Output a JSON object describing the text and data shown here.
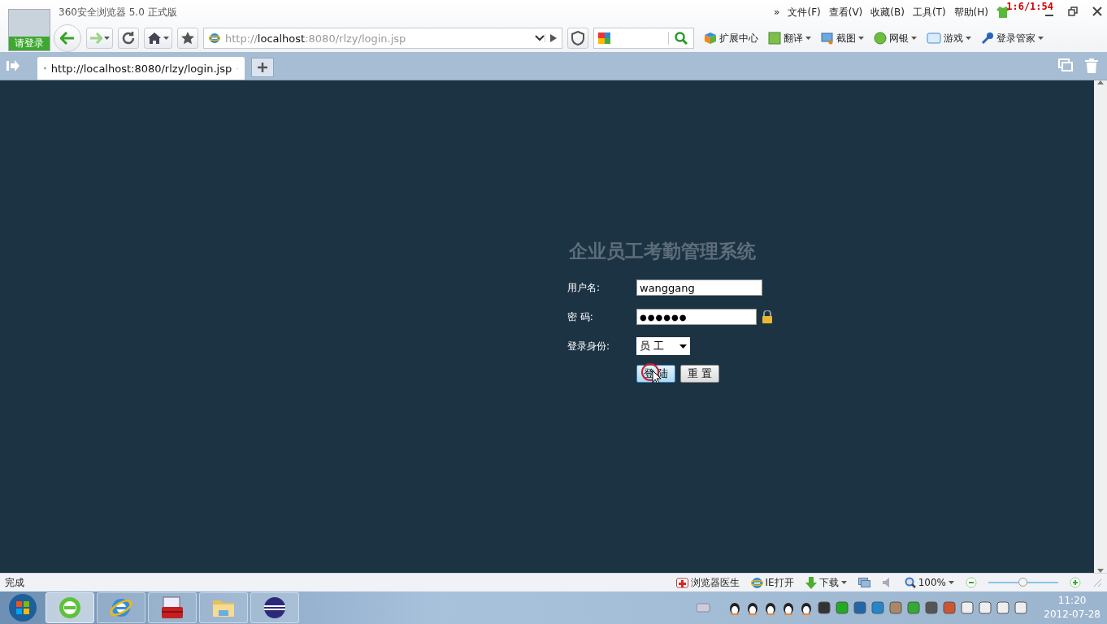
{
  "window": {
    "title": "360安全浏览器 5.0 正式版",
    "login_badge": "请登录",
    "overlay_timer": "1:6/1:54"
  },
  "menu": [
    "»",
    "文件(F)",
    "查看(V)",
    "收藏(B)",
    "工具(T)",
    "帮助(H)"
  ],
  "toolbar": {
    "address": "http://**localhost**:8080/rlzy/login.jsp",
    "extensions": [
      {
        "kind": "cube",
        "label": "扩展中心",
        "dropdown": false
      },
      {
        "kind": "translate",
        "label": "翻译",
        "dropdown": true
      },
      {
        "kind": "screenshot",
        "label": "截图",
        "dropdown": true
      },
      {
        "kind": "bank",
        "label": "网银",
        "dropdown": true
      },
      {
        "kind": "game",
        "label": "游戏",
        "dropdown": true
      },
      {
        "kind": "key",
        "label": "登录管家",
        "dropdown": true
      }
    ]
  },
  "tabs": [
    {
      "label": "http://localhost:8080/rlzy/login.jsp",
      "selected": true
    }
  ],
  "page": {
    "title": "企业员工考勤管理系统",
    "fields": [
      {
        "kind": "text",
        "label": "用户名:",
        "value": "wanggang"
      },
      {
        "kind": "password",
        "label": "密 码:",
        "value": "●●●●●●"
      },
      {
        "kind": "select",
        "label": "登录身份:",
        "value": "员 工"
      }
    ],
    "buttons": [
      {
        "label": "登 陆",
        "focused": true
      },
      {
        "label": "重 置",
        "focused": false
      }
    ]
  },
  "status_bar": {
    "text": "完成",
    "items": [
      {
        "kind": "doctor",
        "label": "浏览器医生",
        "dropdown": false
      },
      {
        "kind": "ie",
        "label": "IE打开",
        "dropdown": false
      },
      {
        "kind": "download",
        "label": "下载",
        "dropdown": true
      }
    ],
    "zoom": {
      "reading": "100%",
      "level": 0.5
    }
  },
  "taskbar": {
    "apps": [
      {
        "kind": "browser360",
        "selected": true
      },
      {
        "kind": "ie",
        "selected": false
      },
      {
        "kind": "toolbox",
        "selected": false
      },
      {
        "kind": "folder",
        "selected": false
      },
      {
        "kind": "eclipse",
        "selected": false
      }
    ],
    "clock": {
      "time": "11:20",
      "date": "2012-07-28"
    }
  }
}
